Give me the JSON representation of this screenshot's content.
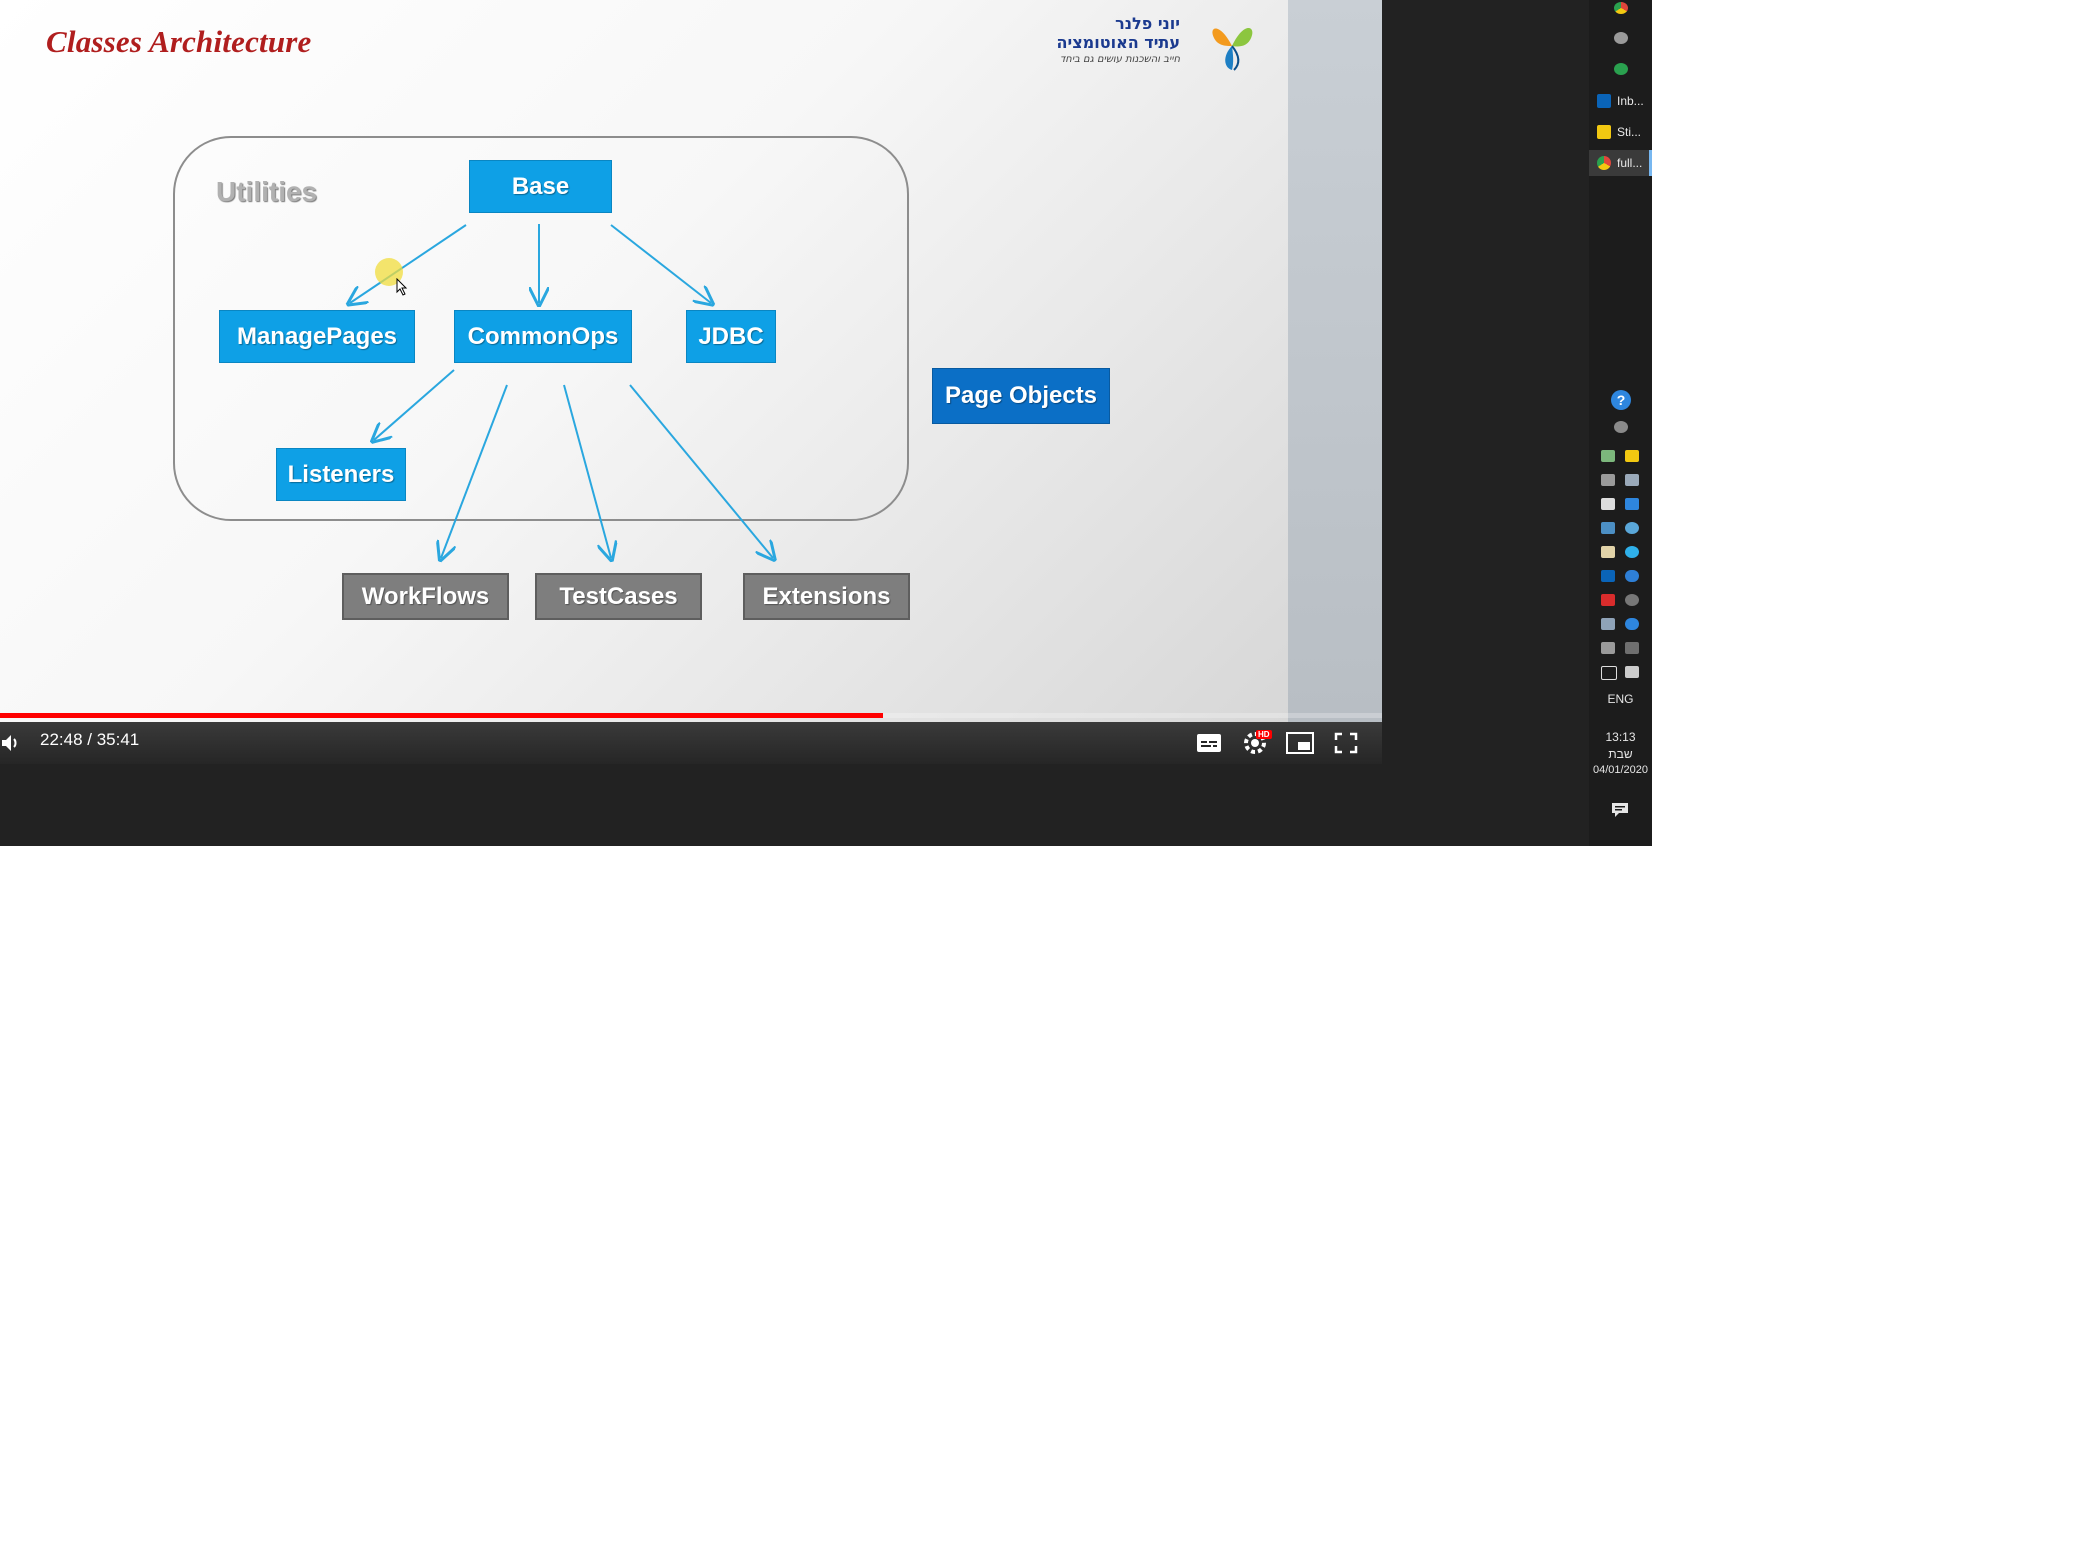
{
  "slide": {
    "title": "Classes Architecture",
    "logo_main": "יוני פלנר\nעתיד האוטומציה",
    "logo_sub": "חייב והשכנות עושים גם ביחד",
    "utilities_label": "Utilities",
    "nodes": {
      "base": "Base",
      "manage_pages": "ManagePages",
      "common_ops": "CommonOps",
      "jdbc": "JDBC",
      "listeners": "Listeners",
      "page_objects": "Page Objects",
      "workflows": "WorkFlows",
      "testcases": "TestCases",
      "extensions": "Extensions"
    },
    "colors": {
      "blue_node": "#0ea0e6",
      "dark_node": "#0b6fc6",
      "gray_node": "#7e7e7e",
      "title": "#b01e1e",
      "arrow": "#2aa7df"
    }
  },
  "player": {
    "time": "22:48 / 35:41",
    "progress": 0.639,
    "controls": [
      "volume-icon",
      "subtitles-icon",
      "settings-icon",
      "miniplayer-icon",
      "fullscreen-icon"
    ],
    "hd_badge": "HD"
  },
  "taskbar": {
    "apps": [
      {
        "label": "Inb...",
        "icon": "outlook-icon",
        "color": "#0a64b8"
      },
      {
        "label": "Sti...",
        "icon": "sticky-notes-icon",
        "color": "#f2c811"
      },
      {
        "label": "full...",
        "icon": "chrome-icon",
        "color": "#e0463b",
        "active": true
      }
    ],
    "language": "ENG",
    "clock_time": "13:13",
    "clock_day": "שבת",
    "clock_date": "04/01/2020"
  }
}
